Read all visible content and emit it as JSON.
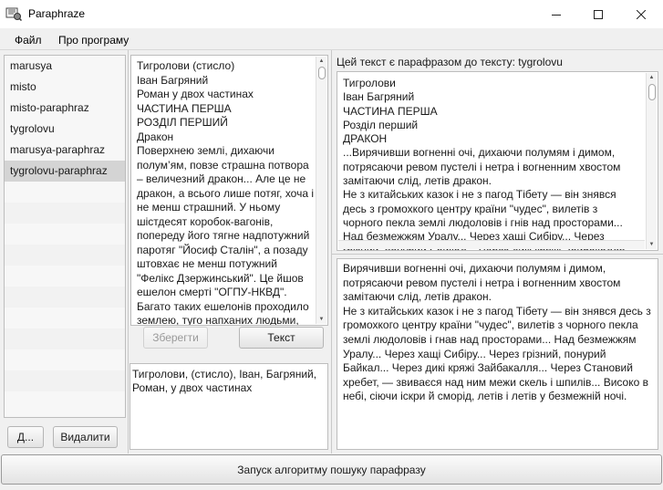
{
  "window": {
    "title": "Paraphraze",
    "icons": {
      "app": "paraphraze-logo-icon",
      "minimize": "minimize-icon",
      "maximize": "maximize-icon",
      "close": "close-icon"
    }
  },
  "menu": {
    "file": "Файл",
    "about": "Про програму"
  },
  "sidebar": {
    "items": [
      {
        "label": "marusya",
        "selected": false
      },
      {
        "label": "misto",
        "selected": false
      },
      {
        "label": "misto-paraphraz",
        "selected": false
      },
      {
        "label": "tygrolovu",
        "selected": false
      },
      {
        "label": "marusya-paraphraz",
        "selected": false
      },
      {
        "label": "tygrolovu-paraphraz",
        "selected": true
      }
    ],
    "add_button": "Д...",
    "delete_button": "Видалити"
  },
  "source": {
    "text": "Тигролови (стисло)\nІван Багряний\nРоман у двох частинах\nЧАСТИНА ПЕРША\nРОЗДІЛ ПЕРШИЙ\nДракон\nПоверхнею землі, дихаючи полум’ям, повзе страшна потвора – величезний дракон... Але це не дракон, а всього лише потяг, хоча і не менш страшний. У ньому шістдесят коробок-вагонів, попереду його тягне надпотужний паротяг \"Йосиф Сталін\", а позаду штовхає не менш потужний \"Фелікс Дзержинський\". Це йшов ешелон смерті \"ОГПУ-НКВД\". Багато таких ешелонів проходило землею, туго напханих людьми, вкритих",
    "save_button": "Зберегти",
    "text_button": "Текст",
    "meta": "Тигролови, (стисло), Іван, Багряний, Роман, у двох частинах"
  },
  "paraphrase": {
    "label": "Цей текст є парафразом до тексту: tygrolovu",
    "text": "Тигролови\nІван Багряний\nЧАСТИНА ПЕРША\nРозділ перший\nДРАКОН\n...Вирячивши вогненні очі, дихаючи полумям і димом, потрясаючи ревом пустелі і нетра і вогненним хвостом замітаючи слід, летів дракон.\nНе з китайських казок і не з пагод Тібету — він знявся десь з громохкого центру країни \"чудес\", вилетів з чорного пекла землі людоловів і гнів над просторами...\nНад безмежжям Уралу... Через хащі Сибіру... Через грізний, понурий Байкал... Через дикі кряжі Зайбакалля..."
  },
  "result": {
    "text": "Вирячивши вогненні очі, дихаючи полумям і димом, потрясаючи ревом пустелі і нетра і вогненним хвостом замітаючи слід, летів дракон.\nНе з китайських казок і не з пагод Тібету — він знявся десь з громохкого центру країни \"чудес\", вилетів з чорного пекла землі людоловів і гнав над просторами... Над безмежжям Уралу... Через хащі Сибіру... Через грізний, понурий Байкал... Через дикі кряжі Зайбакалля... Через Становий хребет, — звиваєся над ним межи скель і шпилів... Високо в небі, сіючи іскри й сморід, летів і летів у безмежній ночі."
  },
  "run_button": "Запуск алгоритму пошуку парафразу",
  "colors": {
    "selected_row": "#d4d4d4",
    "panel_border": "#bdbdbd",
    "background": "#f0f0f0"
  }
}
